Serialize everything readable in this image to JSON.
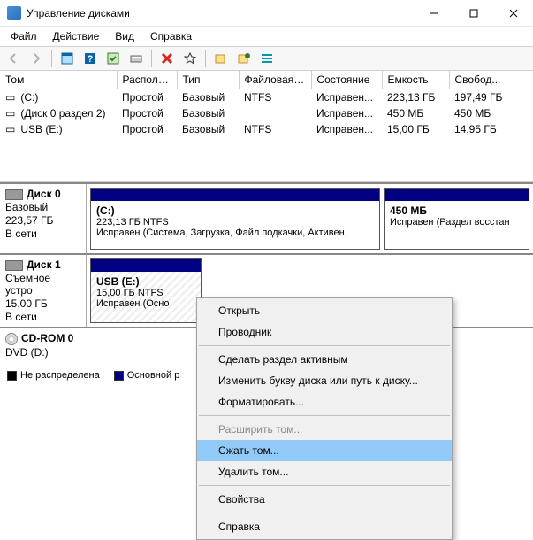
{
  "title": "Управление дисками",
  "menu": {
    "file": "Файл",
    "action": "Действие",
    "view": "Вид",
    "help": "Справка"
  },
  "columns": {
    "volume": "Том",
    "layout": "Располо...",
    "type": "Тип",
    "fs": "Файловая с...",
    "status": "Состояние",
    "capacity": "Емкость",
    "free": "Свобод..."
  },
  "volumes": [
    {
      "icon": "drive",
      "name": "(C:)",
      "layout": "Простой",
      "type": "Базовый",
      "fs": "NTFS",
      "status": "Исправен...",
      "capacity": "223,13 ГБ",
      "free": "197,49 ГБ"
    },
    {
      "icon": "drive",
      "name": "(Диск 0 раздел 2)",
      "layout": "Простой",
      "type": "Базовый",
      "fs": "",
      "status": "Исправен...",
      "capacity": "450 МБ",
      "free": "450 МБ"
    },
    {
      "icon": "drive",
      "name": "USB (E:)",
      "layout": "Простой",
      "type": "Базовый",
      "fs": "NTFS",
      "status": "Исправен...",
      "capacity": "15,00 ГБ",
      "free": "14,95 ГБ"
    }
  ],
  "disks": {
    "d0": {
      "name": "Диск 0",
      "type": "Базовый",
      "size": "223,57 ГБ",
      "status": "В сети",
      "p1": {
        "name": "(C:)",
        "info": "223,13 ГБ NTFS",
        "status": "Исправен (Система, Загрузка, Файл подкачки, Активен,"
      },
      "p2": {
        "name": "450 МБ",
        "status": "Исправен (Раздел восстан"
      }
    },
    "d1": {
      "name": "Диск 1",
      "type": "Съемное устро",
      "size": "15,00 ГБ",
      "status": "В сети",
      "p1": {
        "name": "USB  (E:)",
        "info": "15,00 ГБ NTFS",
        "status": "Исправен (Осно"
      }
    },
    "cd": {
      "name": "CD-ROM 0",
      "sub": "DVD (D:)"
    }
  },
  "legend": {
    "unalloc": "Не распределена",
    "primary": "Основной р"
  },
  "ctx": {
    "open": "Открыть",
    "explorer": "Проводник",
    "active": "Сделать раздел активным",
    "letter": "Изменить букву диска или путь к диску...",
    "format": "Форматировать...",
    "extend": "Расширить том...",
    "shrink": "Сжать том...",
    "delete": "Удалить том...",
    "props": "Свойства",
    "help": "Справка"
  }
}
